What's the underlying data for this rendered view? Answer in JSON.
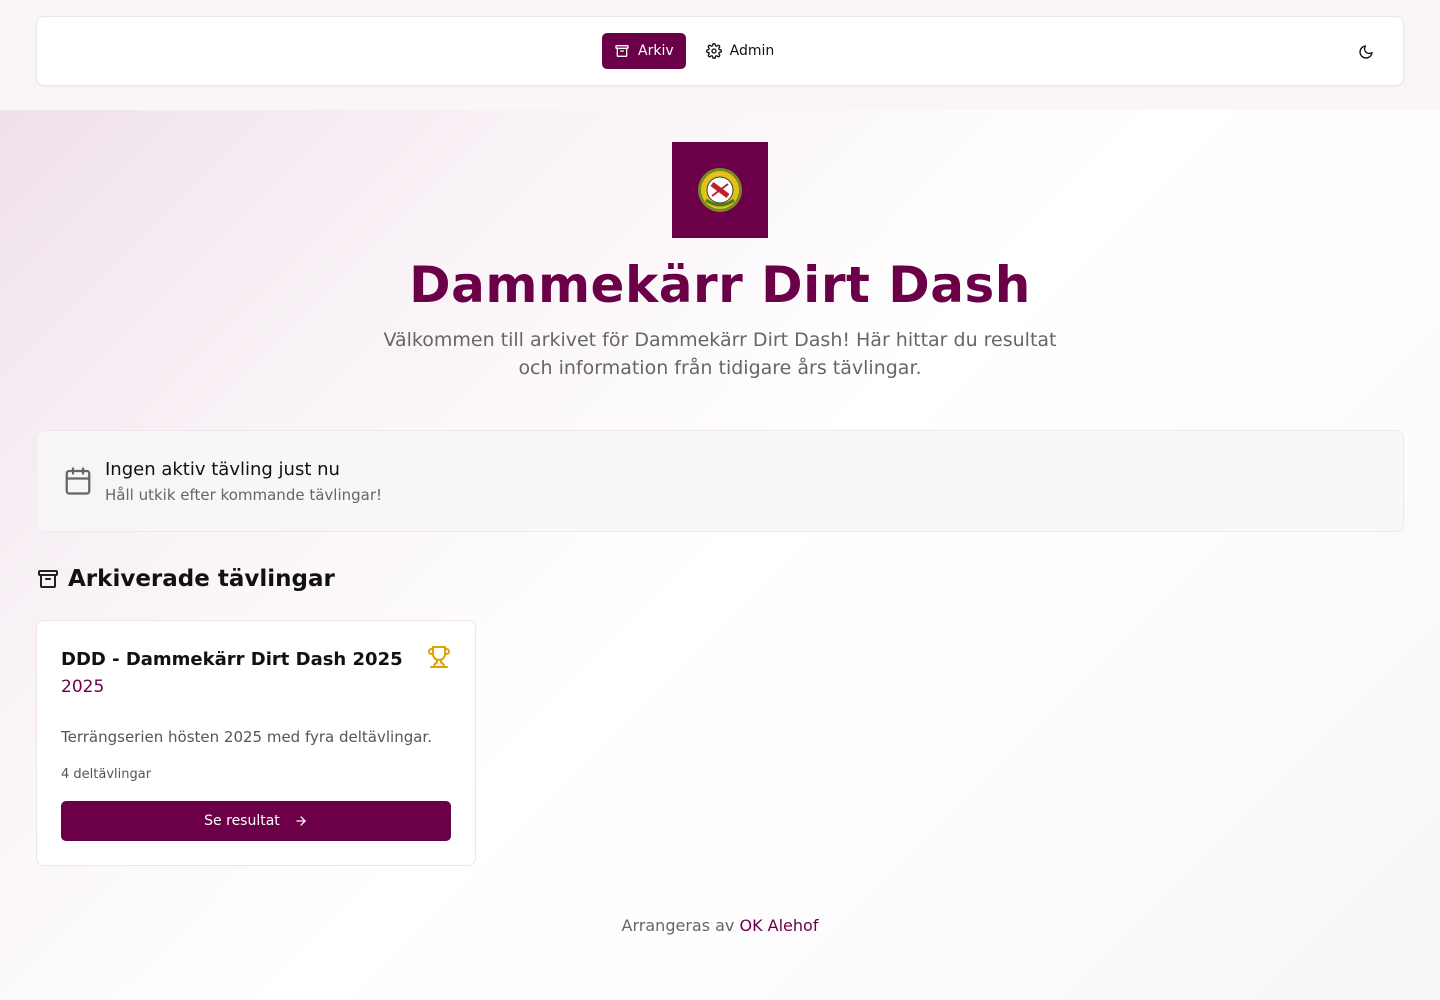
{
  "nav": {
    "items": [
      {
        "label": "Arkiv",
        "icon": "archive-icon",
        "active": true
      },
      {
        "label": "Admin",
        "icon": "gear-icon",
        "active": false
      }
    ],
    "theme_toggle_icon": "moon-icon"
  },
  "hero": {
    "title": "Dammekärr Dirt Dash",
    "subtitle": "Välkommen till arkivet för Dammekärr Dirt Dash! Här hittar du resultat och information från tidigare års tävlingar."
  },
  "notice": {
    "icon": "calendar-icon",
    "title": "Ingen aktiv tävling just nu",
    "subtitle": "Håll utkik efter kommande tävlingar!"
  },
  "archive": {
    "heading": "Arkiverade tävlingar",
    "cards": [
      {
        "title": "DDD - Dammekärr Dirt Dash 2025",
        "year": "2025",
        "description": "Terrängserien hösten 2025 med fyra deltävlingar.",
        "count": "4 deltävlingar",
        "button_label": "Se resultat",
        "icon": "trophy-icon"
      }
    ]
  },
  "footer": {
    "prefix": "Arrangeras av",
    "link": "OK Alehof"
  },
  "colors": {
    "brand": "#6b0048",
    "trophy": "#e0a000"
  }
}
